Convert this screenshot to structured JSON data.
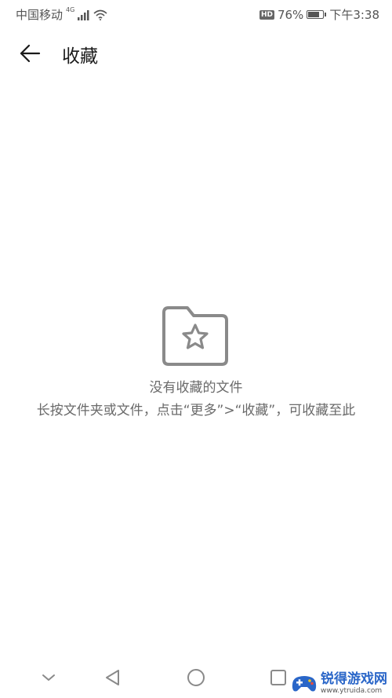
{
  "status_bar": {
    "carrier": "中国移动",
    "network": "4G",
    "battery_percent_text": "76%",
    "battery_level": 0.76,
    "hd_label": "HD",
    "time": "下午3:38"
  },
  "header": {
    "title": "收藏"
  },
  "empty_state": {
    "title": "没有收藏的文件",
    "hint": "长按文件夹或文件，点击“更多”>“收藏”，可收藏至此"
  },
  "watermark": {
    "name": "锐得游戏网",
    "url": "www.ytruida.com"
  },
  "colors": {
    "icon_gray": "#8a8a8a",
    "text_gray": "#6a6a6a"
  }
}
